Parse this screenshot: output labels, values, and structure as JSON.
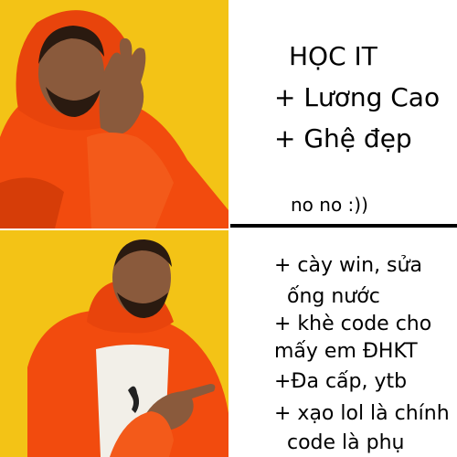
{
  "top_panel": {
    "title": "HỌC IT",
    "lines": [
      "+ Lương Cao",
      "+ Ghệ đẹp"
    ],
    "note": "no no :))"
  },
  "bottom_panel": {
    "lines": [
      "+ cày win, sửa",
      "  ống nước",
      "+ khè code cho",
      "mấy em ĐHKT",
      "+Đa cấp, ytb",
      "+ xạo lol là chính",
      "  code là phụ"
    ]
  },
  "colors": {
    "background_yellow": "#f3c316",
    "jacket_orange": "#f24b0e",
    "skin": "#8a5a3c",
    "shirt": "#f2efe8"
  },
  "icons": [
    "drake-disapproving-image",
    "drake-approving-image"
  ]
}
